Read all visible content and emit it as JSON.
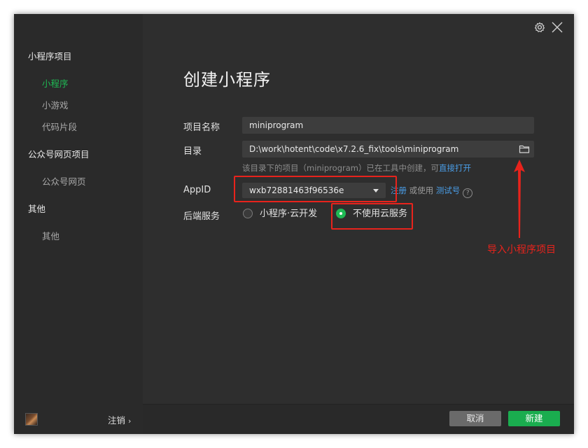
{
  "sidebar": {
    "groups": [
      {
        "label": "小程序项目",
        "items": [
          {
            "label": "小程序",
            "active": true
          },
          {
            "label": "小游戏",
            "active": false
          },
          {
            "label": "代码片段",
            "active": false
          }
        ]
      },
      {
        "label": "公众号网页项目",
        "items": [
          {
            "label": "公众号网页",
            "active": false
          }
        ]
      },
      {
        "label": "其他",
        "items": [
          {
            "label": "其他",
            "active": false
          }
        ]
      }
    ],
    "logout_label": "注销",
    "logout_chevron": "›"
  },
  "header": {
    "icons": [
      "gear-icon",
      "close-icon"
    ]
  },
  "form": {
    "title": "创建小程序",
    "project_name": {
      "label": "项目名称",
      "value": "miniprogram"
    },
    "directory": {
      "label": "目录",
      "value": "D:\\work\\hotent\\code\\x7.2.6_fix\\tools\\miniprogram",
      "hint_prefix": "该目录下的项目（miniprogram）已在工具中创建，可",
      "hint_link": "直接打开"
    },
    "appid": {
      "label": "AppID",
      "value": "wxb72881463f96536e",
      "register_link": "注册",
      "or_use": "或使用",
      "test_link": "测试号",
      "help": "?"
    },
    "backend": {
      "label": "后端服务",
      "options": [
        {
          "label": "小程序·云开发",
          "selected": false
        },
        {
          "label": "不使用云服务",
          "selected": true
        }
      ]
    }
  },
  "footer": {
    "cancel_label": "取消",
    "create_label": "新建"
  },
  "annotation": {
    "text": "导入小程序项目"
  },
  "colors": {
    "accent_green": "#1fb954",
    "link_blue": "#4a9ee8",
    "annotation_red": "#e8231c",
    "sidebar_bg": "#2a2a2a",
    "main_bg": "#2e2e2e"
  }
}
